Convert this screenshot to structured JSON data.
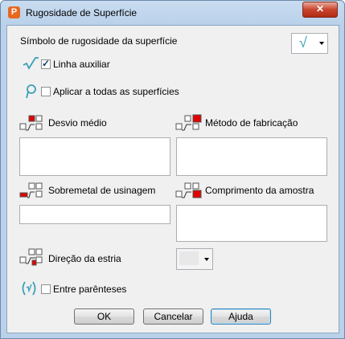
{
  "window": {
    "title": "Rugosidade de Superfície",
    "app_icon": "P",
    "close_label": "✕"
  },
  "symbol": {
    "label": "Símbolo de rugosidade da superfície",
    "selected_glyph": "√"
  },
  "options": {
    "aux_line": {
      "label": "Linha auxiliar",
      "checked": true
    },
    "apply_all": {
      "label": "Aplicar a todas as superfícies",
      "checked": false
    },
    "parentheses": {
      "label": "Entre parênteses",
      "checked": false
    }
  },
  "fields": {
    "desvio": {
      "label": "Desvio médio",
      "value": ""
    },
    "metodo": {
      "label": "Método de fabricação",
      "value": ""
    },
    "sobremetal": {
      "label": "Sobremetal de usinagem",
      "value": ""
    },
    "comprimento": {
      "label": "Comprimento da amostra",
      "value": ""
    },
    "direcao": {
      "label": "Direção da estria",
      "value": ""
    }
  },
  "buttons": {
    "ok": "OK",
    "cancel": "Cancelar",
    "help": "Ajuda"
  },
  "colors": {
    "accent_red": "#e00000",
    "check_icon": "#3aa0b8"
  },
  "icons": {
    "aux_line": "check-root-icon",
    "apply_all": "surface-all-icon",
    "parentheses": "paren-symbol-icon"
  }
}
